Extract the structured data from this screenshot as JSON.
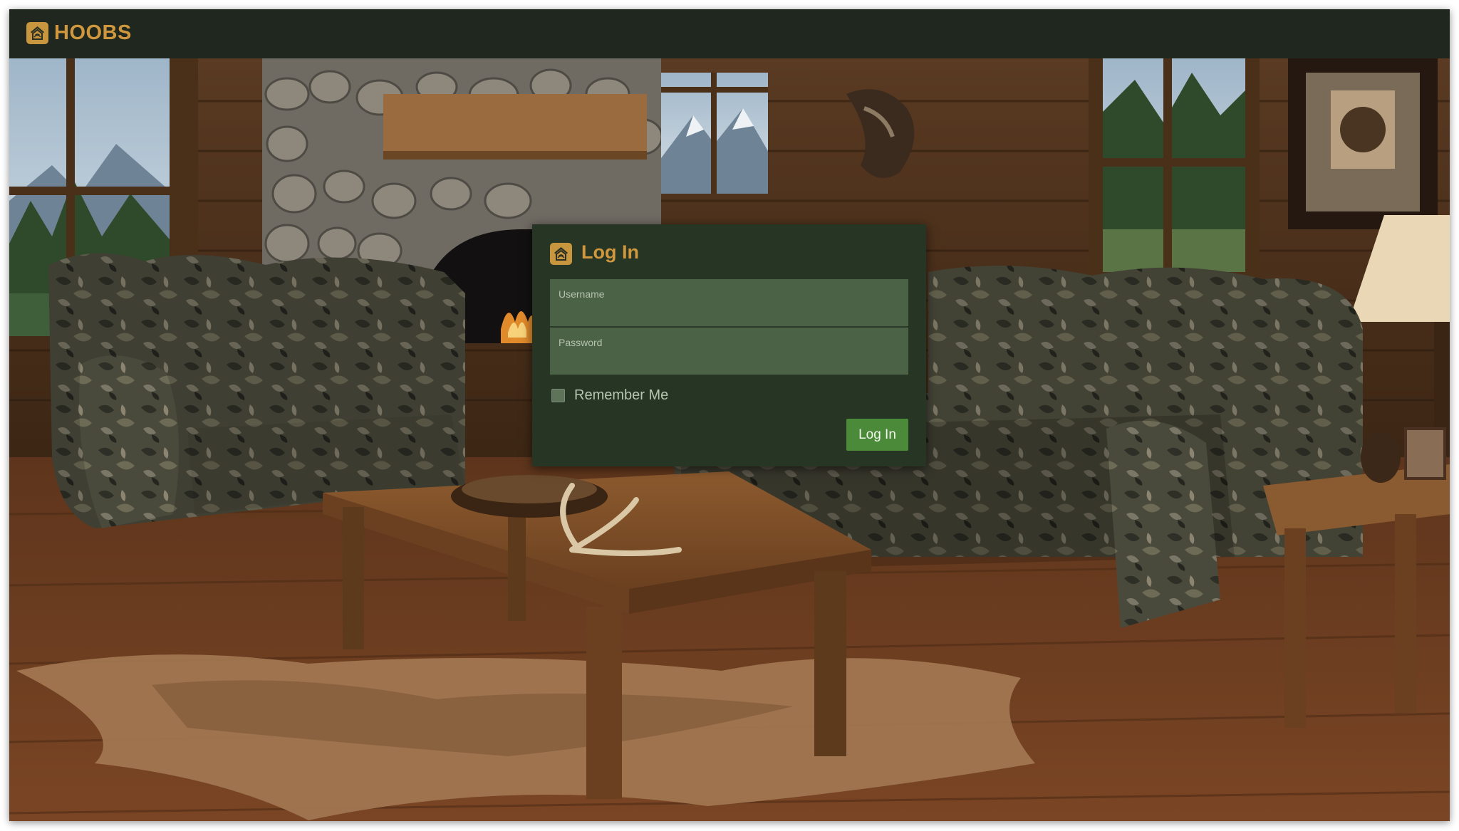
{
  "app": {
    "brand": "HOOBS",
    "logo_icon": "hoobs-logo-icon",
    "accent_color": "#d0983e",
    "topbar_color": "#1f271e"
  },
  "background": {
    "image_icon": "cabin-living-room-photo"
  },
  "login": {
    "title": "Log In",
    "username_label": "Username",
    "username_value": "",
    "password_label": "Password",
    "password_value": "",
    "remember_label": "Remember Me",
    "remember_checked": false,
    "submit_label": "Log In",
    "card_color": "#263524",
    "button_color": "#4a8a38"
  }
}
